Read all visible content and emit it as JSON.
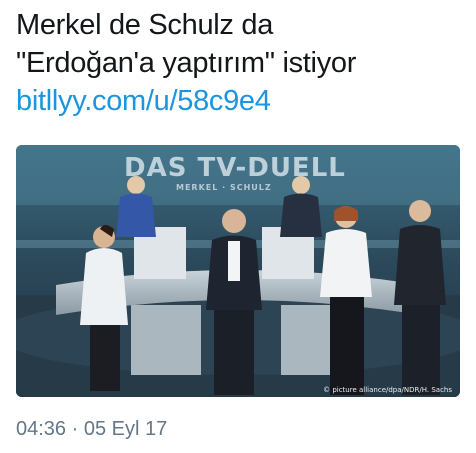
{
  "tweet": {
    "line1": "Merkel de Schulz da",
    "line2": "\"Erdoğan'a yaptırım\" istiyor",
    "link": "bitllyy.com/u/58c9e4"
  },
  "media": {
    "studio_logo": "DAS TV-DUELL",
    "studio_sub": "MERKEL · SCHULZ",
    "credit": "© picture alliance/dpa/NDR/H. Sachs"
  },
  "meta": {
    "time": "04:36",
    "separator": "·",
    "date": "05 Eyl 17"
  },
  "colors": {
    "link": "#1b95e0",
    "text": "#14171a",
    "meta": "#657786"
  }
}
